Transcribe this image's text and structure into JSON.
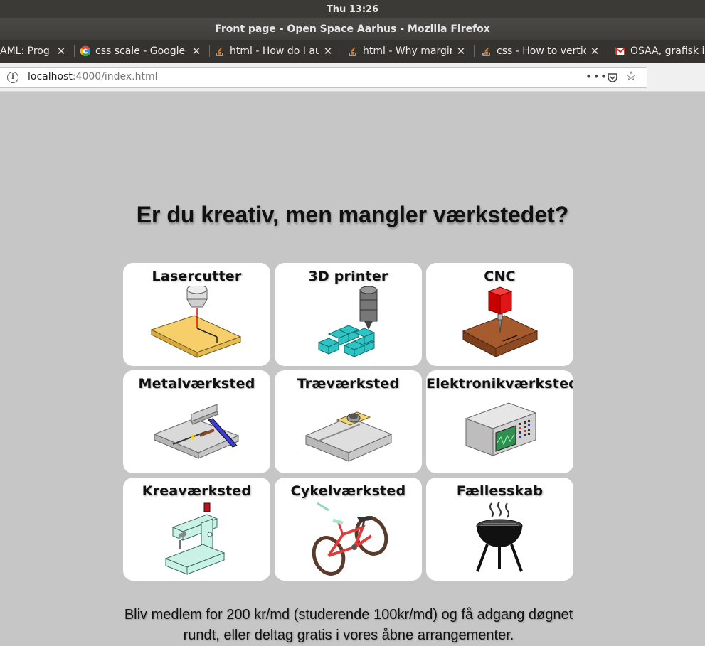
{
  "os": {
    "clock": "Thu 13:26"
  },
  "window": {
    "title": "Front page - Open Space Aarhus - Mozilla Firefox"
  },
  "tabs": [
    {
      "label": "AML: Progr",
      "icon": "generic-icon"
    },
    {
      "label": "css scale - Google-s",
      "icon": "google-icon"
    },
    {
      "label": "html - How do I aut",
      "icon": "stackoverflow-icon"
    },
    {
      "label": "html - Why margins",
      "icon": "stackoverflow-icon"
    },
    {
      "label": "css - How to vertica",
      "icon": "stackoverflow-icon"
    },
    {
      "label": "OSAA, grafisk ic",
      "icon": "gmail-icon"
    }
  ],
  "address": {
    "host": "localhost",
    "path": ":4000/index.html",
    "menu": "•••"
  },
  "page": {
    "headline": "Er du kreativ, men mangler værkstedet?",
    "cards": [
      {
        "title": "Lasercutter",
        "icon": "lasercutter-icon"
      },
      {
        "title": "3D printer",
        "icon": "3d-printer-icon"
      },
      {
        "title": "CNC",
        "icon": "cnc-icon"
      },
      {
        "title": "Metalværksted",
        "icon": "metal-workshop-icon"
      },
      {
        "title": "Træværksted",
        "icon": "wood-workshop-icon"
      },
      {
        "title": "Elektronikværksted",
        "icon": "electronics-workshop-icon"
      },
      {
        "title": "Kreaværksted",
        "icon": "sewing-machine-icon"
      },
      {
        "title": "Cykelværksted",
        "icon": "bicycle-icon"
      },
      {
        "title": "Fællesskab",
        "icon": "grill-icon"
      }
    ],
    "membership_line1": "Bliv medlem for 200 kr/md (studerende 100kr/md) og få adgang døgnet",
    "membership_line2": "rundt, eller deltag gratis i vores åbne arrangementer."
  }
}
